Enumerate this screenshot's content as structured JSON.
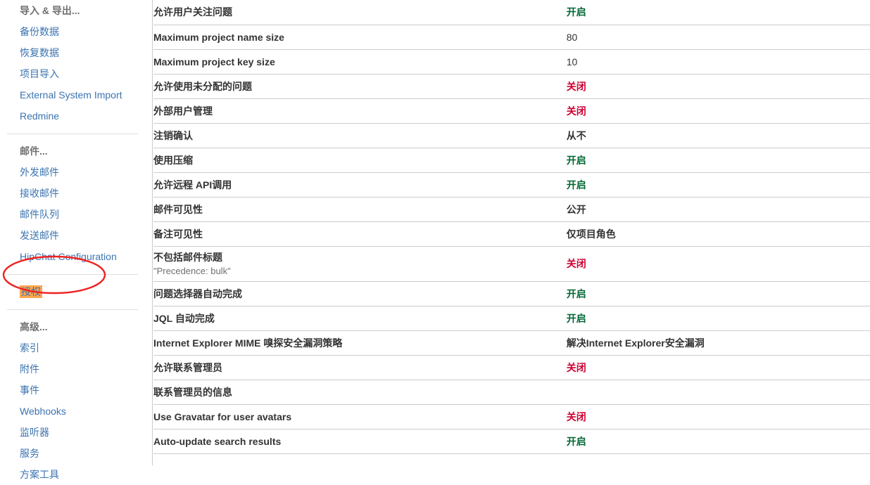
{
  "sidebar": {
    "sections": [
      {
        "header": "导入 & 导出...",
        "items": [
          {
            "label": "备份数据",
            "highlighted": false
          },
          {
            "label": "恢复数据",
            "highlighted": false
          },
          {
            "label": "项目导入",
            "highlighted": false
          },
          {
            "label": "External System Import",
            "highlighted": false
          },
          {
            "label": "Redmine",
            "highlighted": false
          }
        ]
      },
      {
        "header": "邮件...",
        "items": [
          {
            "label": "外发邮件",
            "highlighted": false
          },
          {
            "label": "接收邮件",
            "highlighted": false
          },
          {
            "label": "邮件队列",
            "highlighted": false
          },
          {
            "label": "发送邮件",
            "highlighted": false
          },
          {
            "label": "HipChat Configuration",
            "highlighted": false
          }
        ]
      },
      {
        "header": "",
        "items": [
          {
            "label": "授权",
            "highlighted": true
          }
        ]
      },
      {
        "header": "高级...",
        "items": [
          {
            "label": "索引",
            "highlighted": false
          },
          {
            "label": "附件",
            "highlighted": false
          },
          {
            "label": "事件",
            "highlighted": false
          },
          {
            "label": "Webhooks",
            "highlighted": false
          },
          {
            "label": "监听器",
            "highlighted": false
          },
          {
            "label": "服务",
            "highlighted": false
          },
          {
            "label": "方案工具",
            "highlighted": false
          }
        ]
      }
    ]
  },
  "settings_table": {
    "rows": [
      {
        "key": "允许用户关注问题",
        "sub": "",
        "value": "开启",
        "value_style": "on"
      },
      {
        "key": "Maximum project name size",
        "sub": "",
        "value": "80",
        "value_style": "plain"
      },
      {
        "key": "Maximum project key size",
        "sub": "",
        "value": "10",
        "value_style": "plain"
      },
      {
        "key": "允许使用未分配的问题",
        "sub": "",
        "value": "关闭",
        "value_style": "off"
      },
      {
        "key": "外部用户管理",
        "sub": "",
        "value": "关闭",
        "value_style": "off"
      },
      {
        "key": "注销确认",
        "sub": "",
        "value": "从不",
        "value_style": "bold"
      },
      {
        "key": "使用压缩",
        "sub": "",
        "value": "开启",
        "value_style": "on"
      },
      {
        "key": "允许远程 API调用",
        "sub": "",
        "value": "开启",
        "value_style": "on"
      },
      {
        "key": "邮件可见性",
        "sub": "",
        "value": "公开",
        "value_style": "bold"
      },
      {
        "key": "备注可见性",
        "sub": "",
        "value": "仅项目角色",
        "value_style": "bold"
      },
      {
        "key": "不包括邮件标题",
        "sub": "\"Precedence: bulk\"",
        "value": "关闭",
        "value_style": "off"
      },
      {
        "key": "问题选择器自动完成",
        "sub": "",
        "value": "开启",
        "value_style": "on"
      },
      {
        "key": "JQL 自动完成",
        "sub": "",
        "value": "开启",
        "value_style": "on"
      },
      {
        "key": "Internet Explorer MIME 嗅探安全漏洞策略",
        "sub": "",
        "value": "解决Internet Explorer安全漏洞",
        "value_style": "bold"
      },
      {
        "key": "允许联系管理员",
        "sub": "",
        "value": "关闭",
        "value_style": "off"
      },
      {
        "key": "联系管理员的信息",
        "sub": "",
        "value": "",
        "value_style": "plain"
      },
      {
        "key": "Use Gravatar for user avatars",
        "sub": "",
        "value": "关闭",
        "value_style": "off"
      },
      {
        "key": "Auto-update search results",
        "sub": "",
        "value": "开启",
        "value_style": "on"
      }
    ]
  },
  "annotation": {
    "shape": "ellipse",
    "color": "#ee2222",
    "target_label": "授权"
  },
  "colors": {
    "link": "#3b73af",
    "on_green": "#006633",
    "off_red": "#cc0033",
    "highlight_bg": "#ffa64d",
    "row_border": "#cccccc",
    "section_header": "#707070"
  }
}
